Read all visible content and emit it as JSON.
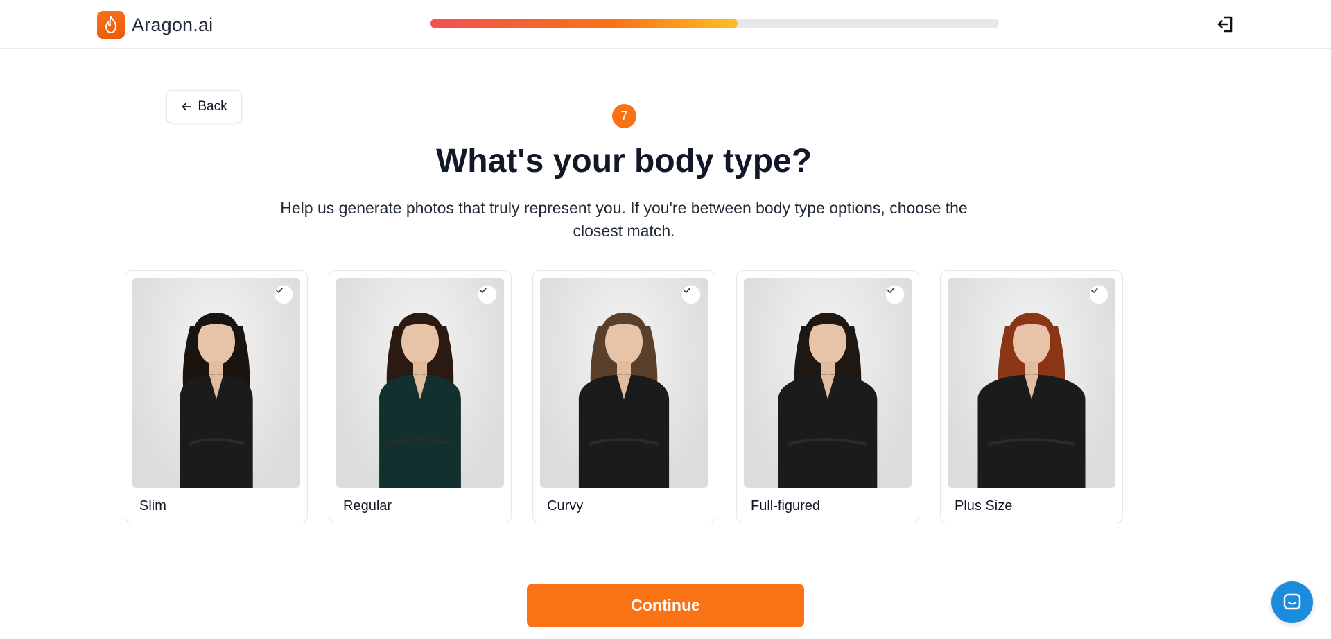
{
  "header": {
    "brand": "Aragon.ai",
    "progress_fraction": 0.54
  },
  "nav": {
    "back_label": "Back"
  },
  "step": {
    "number": "7"
  },
  "question": {
    "title": "What's your body type?",
    "subtitle": "Help us generate photos that truly represent you. If you're between body type options, choose the closest match."
  },
  "options": [
    {
      "label": "Slim",
      "hair": "#1a1410",
      "top": "#1b1b1b",
      "body_width": 0.85
    },
    {
      "label": "Regular",
      "hair": "#2a1a12",
      "top": "#12302d",
      "body_width": 0.95
    },
    {
      "label": "Curvy",
      "hair": "#5a3f2a",
      "top": "#1b1b1b",
      "body_width": 1.05
    },
    {
      "label": "Full-figured",
      "hair": "#1f1812",
      "top": "#1b1b1b",
      "body_width": 1.15
    },
    {
      "label": "Plus Size",
      "hair": "#8a3516",
      "top": "#1b1b1b",
      "body_width": 1.25
    }
  ],
  "footer": {
    "continue_label": "Continue"
  },
  "colors": {
    "accent": "#f97316",
    "chat": "#1a8cdb"
  }
}
